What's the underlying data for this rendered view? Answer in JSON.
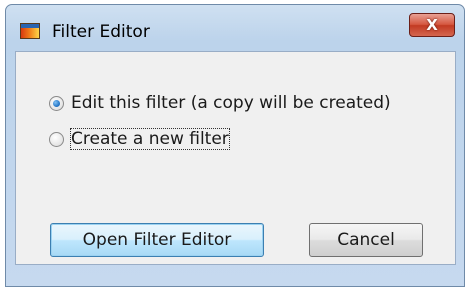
{
  "window": {
    "title": "Filter Editor",
    "close_glyph": "X"
  },
  "options": [
    {
      "label": "Edit this filter (a copy will be created)",
      "selected": true
    },
    {
      "label": "Create a new filter",
      "selected": false
    }
  ],
  "buttons": {
    "open_label": "Open Filter Editor",
    "cancel_label": "Cancel"
  }
}
